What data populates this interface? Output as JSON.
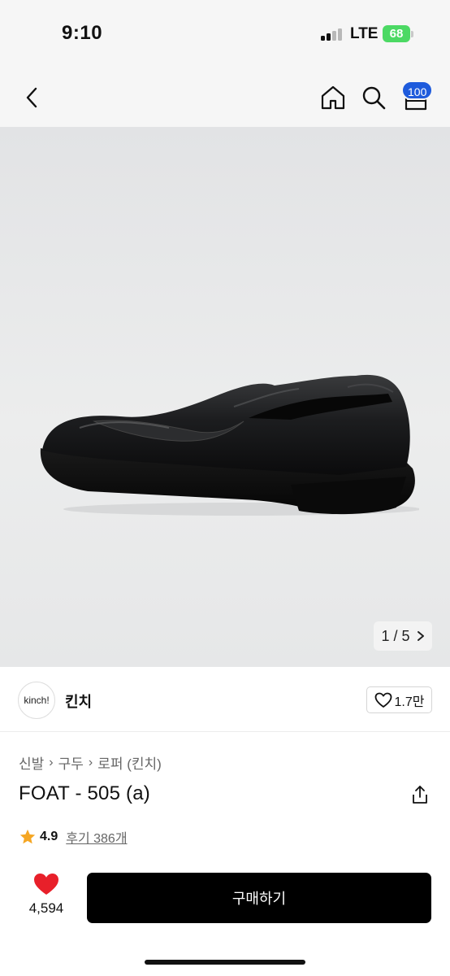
{
  "status_bar": {
    "time": "9:10",
    "network": "LTE",
    "battery": "68",
    "battery_color": "#4cd964"
  },
  "nav": {
    "back_icon": "chevron-left-icon",
    "home_icon": "home-icon",
    "search_icon": "search-icon",
    "cart_icon": "cart-icon",
    "cart_count": "100",
    "badge_color": "#1e5bdc"
  },
  "gallery": {
    "current": "1",
    "total": "5",
    "separator": "/"
  },
  "brand": {
    "logo_text": "kinch!",
    "name": "킨치",
    "likes": "1.7만"
  },
  "breadcrumb": [
    "신발",
    "구두",
    "로퍼 (킨치)"
  ],
  "product": {
    "title": "FOAT - 505 (a)"
  },
  "rating": {
    "score": "4.9",
    "reviews": "후기 386개",
    "star_color": "#f5a623"
  },
  "bottom_bar": {
    "wish_count": "4,594",
    "heart_color": "#e8202a",
    "buy_label": "구매하기"
  }
}
